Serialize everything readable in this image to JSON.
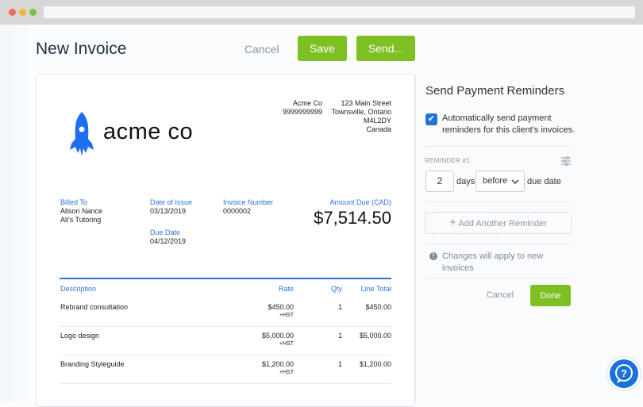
{
  "header": {
    "title": "New Invoice",
    "cancel": "Cancel",
    "save": "Save",
    "send": "Send..."
  },
  "invoice": {
    "logo_text": "acme co",
    "company": {
      "name": "Acme Co",
      "phone": "9999999999",
      "street": "123 Main Street",
      "city": "Townsville, Ontario",
      "postal": "M4L2DY",
      "country": "Canada"
    },
    "billed_to": {
      "label": "Billed To",
      "name": "Alison Nance",
      "company": "Ali's Tutoring"
    },
    "date_of_issue": {
      "label": "Date of Issue",
      "value": "03/13/2019"
    },
    "due_date": {
      "label": "Due Date",
      "value": "04/12/2019"
    },
    "invoice_number": {
      "label": "Invoice Number",
      "value": "0000002"
    },
    "amount_due": {
      "label": "Amount Due (CAD)",
      "value": "$7,514.50"
    },
    "columns": [
      "Description",
      "Rate",
      "Qty",
      "Line Total"
    ],
    "rows": [
      {
        "description": "Rebrand consultation",
        "rate": "$450.00",
        "tax": "+HST",
        "qty": "1",
        "total": "$450.00"
      },
      {
        "description": "Logo design",
        "rate": "$5,000.00",
        "tax": "+HST",
        "qty": "1",
        "total": "$5,000.00"
      },
      {
        "description": "Branding Styleguide",
        "rate": "$1,200.00",
        "tax": "+HST",
        "qty": "1",
        "total": "$1,200.00"
      }
    ]
  },
  "reminders": {
    "title": "Send Payment Reminders",
    "auto_send_label": "Automatically send payment reminders for this client's invoices.",
    "auto_send_checked": true,
    "reminder_label": "REMINDER #1",
    "days_value": "2",
    "days_label": "days",
    "timing": "before",
    "due_label": "due date",
    "add_label": "Add Another Reminder",
    "notice": "Changes will apply to new invoices",
    "cancel": "Cancel",
    "done": "Done"
  },
  "colors": {
    "accent": "#7dc021",
    "blue": "#2f73d8",
    "help": "#1a73d9"
  }
}
